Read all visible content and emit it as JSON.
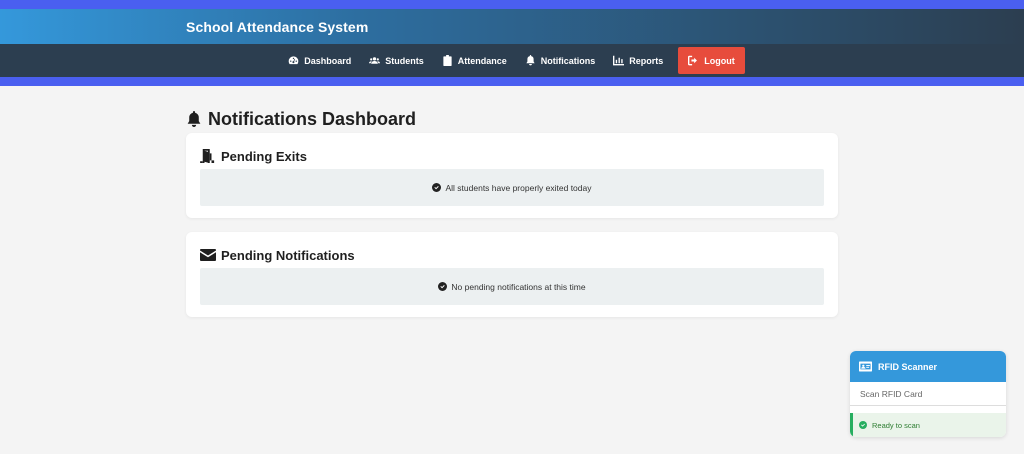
{
  "app": {
    "title": "School Attendance System"
  },
  "nav": {
    "items": [
      {
        "label": "Dashboard",
        "icon": "gauge-icon"
      },
      {
        "label": "Students",
        "icon": "users-icon"
      },
      {
        "label": "Attendance",
        "icon": "clipboard-check-icon"
      },
      {
        "label": "Notifications",
        "icon": "bell-icon"
      },
      {
        "label": "Reports",
        "icon": "chart-icon"
      }
    ],
    "logout": {
      "label": "Logout",
      "icon": "logout-icon"
    }
  },
  "page": {
    "title": "Notifications Dashboard",
    "icon": "bell-icon"
  },
  "pending_exits": {
    "title": "Pending Exits",
    "icon": "door-exit-icon",
    "message": "All students have properly exited today"
  },
  "pending_notifications": {
    "title": "Pending Notifications",
    "icon": "envelope-icon",
    "message": "No pending notifications at this time"
  },
  "rfid": {
    "title": "RFID Scanner",
    "icon": "id-card-icon",
    "input_placeholder": "Scan RFID Card",
    "status": "Ready to scan"
  },
  "colors": {
    "accent_strip": "#4a5ff0",
    "nav_bg": "#2c3e50",
    "primary": "#3498db",
    "logout": "#e74c3c",
    "success": "#27ae60"
  }
}
